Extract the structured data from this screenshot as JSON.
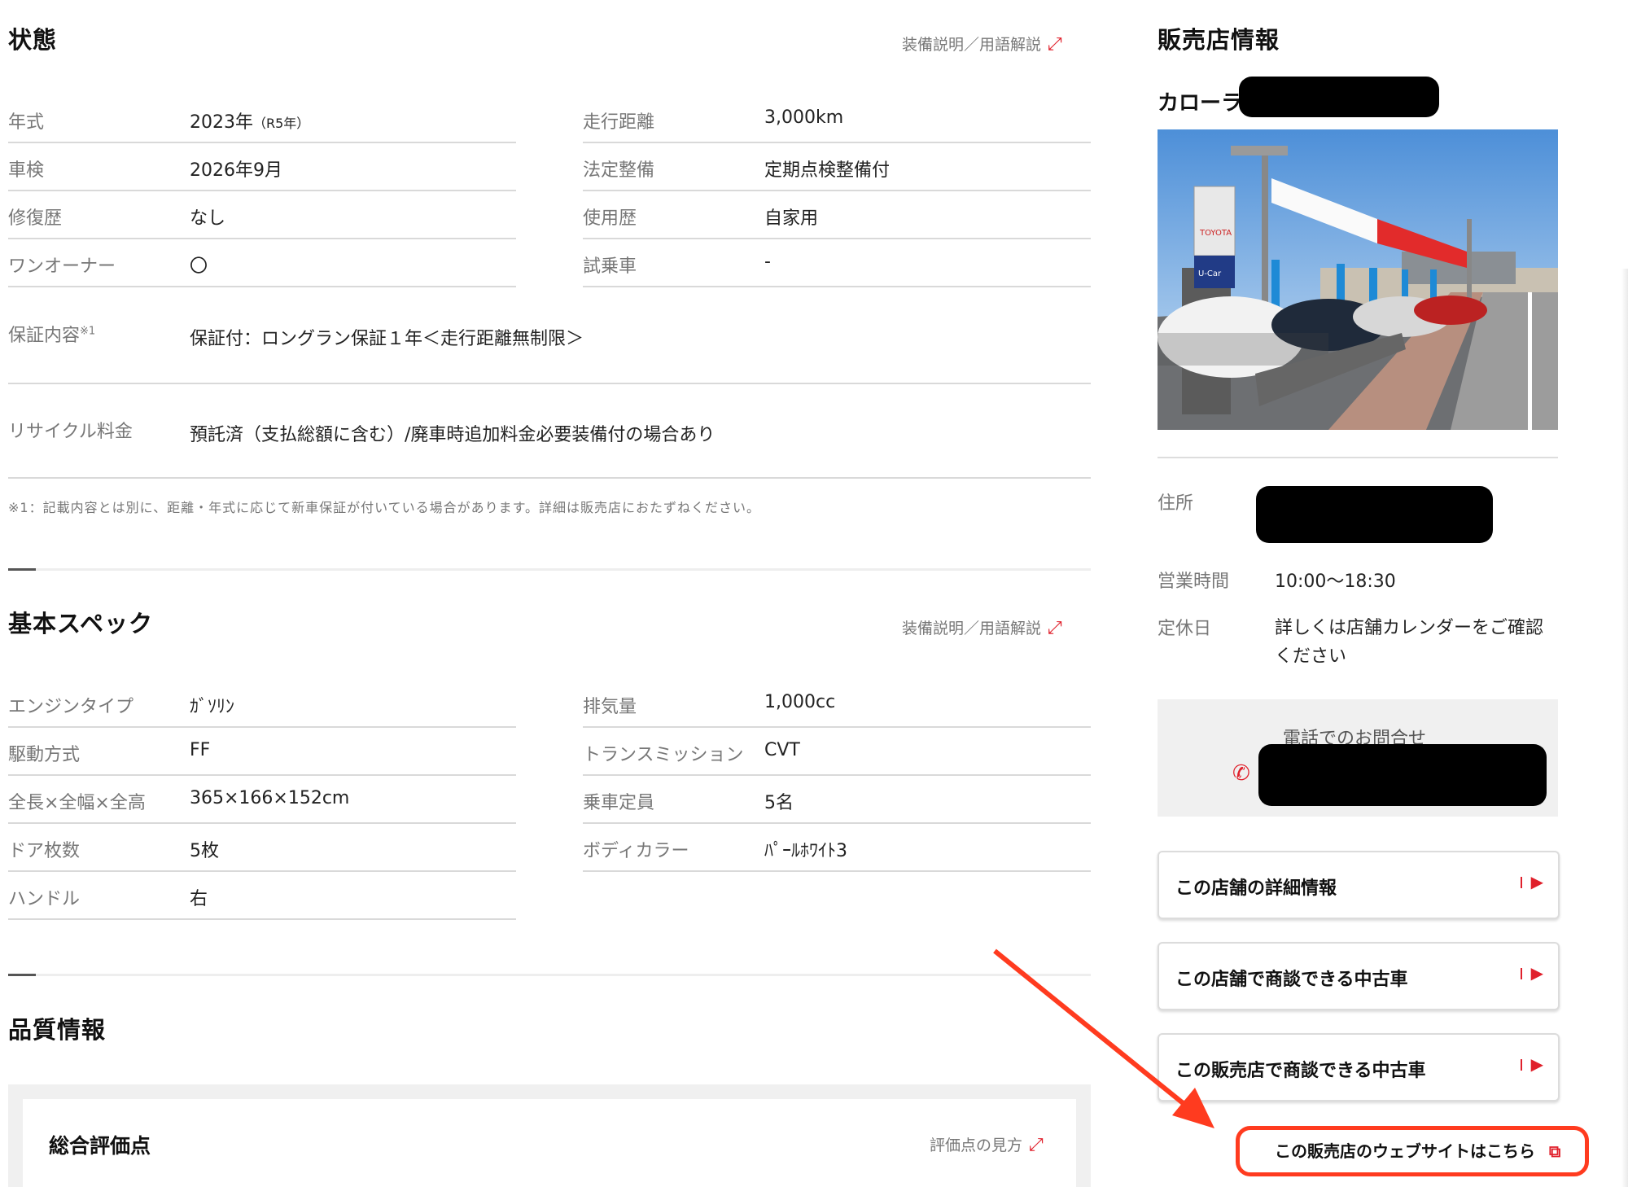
{
  "condition": {
    "title": "状態",
    "glossary_link": "装備説明／用語解説",
    "left_rows": [
      {
        "label": "年式",
        "value": "2023年",
        "sub": "（R5年）"
      },
      {
        "label": "車検",
        "value": "2026年9月"
      },
      {
        "label": "修復歴",
        "value": "なし"
      },
      {
        "label": "ワンオーナー",
        "value": "〇"
      }
    ],
    "right_rows": [
      {
        "label": "走行距離",
        "value": "3,000km"
      },
      {
        "label": "法定整備",
        "value": "定期点検整備付"
      },
      {
        "label": "使用歴",
        "value": "自家用"
      },
      {
        "label": "試乗車",
        "value": "-"
      }
    ],
    "warranty_label": "保証内容",
    "warranty_note_mark": "※1",
    "warranty_value": "保証付：ロングラン保証１年＜走行距離無制限＞",
    "recycle_label": "リサイクル料金",
    "recycle_value": "預託済（支払総額に含む）/廃車時追加料金必要装備付の場合あり",
    "footnote": "※1：記載内容とは別に、距離・年式に応じて新車保証が付いている場合があります。詳細は販売店におたずねください。"
  },
  "specs": {
    "title": "基本スペック",
    "glossary_link": "装備説明／用語解説",
    "left_rows": [
      {
        "label": "エンジンタイプ",
        "value": "ｶﾞｿﾘﾝ"
      },
      {
        "label": "駆動方式",
        "value": "FF"
      },
      {
        "label": "全長×全幅×全高",
        "value": "365×166×152cm"
      },
      {
        "label": "ドア枚数",
        "value": "5枚"
      },
      {
        "label": "ハンドル",
        "value": "右"
      }
    ],
    "right_rows": [
      {
        "label": "排気量",
        "value": "1,000cc"
      },
      {
        "label": "トランスミッション",
        "value": "CVT"
      },
      {
        "label": "乗車定員",
        "value": "5名"
      },
      {
        "label": "ボディカラー",
        "value": "ﾊﾟｰﾙﾎﾜｲﾄ3"
      }
    ]
  },
  "quality": {
    "title": "品質情報",
    "score_title": "総合評価点",
    "score_link": "評価点の見方"
  },
  "dealer": {
    "title": "販売店情報",
    "name_prefix": "カローラ",
    "address_label": "住所",
    "hours_label": "営業時間",
    "hours_value": "10:00〜18:30",
    "holiday_label": "定休日",
    "holiday_value_line1": "詳しくは店舗カレンダーをご確認",
    "holiday_value_line2": "ください",
    "phone_label": "電話でのお問合せ",
    "buttons": [
      "この店舗の詳細情報",
      "この店舗で商談できる中古車",
      "この販売店で商談できる中古車"
    ],
    "website_link": "この販売店のウェブサイトはこちら",
    "photo_signs": {
      "toyota": "TOYOTA",
      "ucar": "U-Car"
    }
  },
  "colors": {
    "accent_red": "#e0202b",
    "annotation_red": "#ff3b1f"
  },
  "icons": [
    "external-link-icon",
    "phone-icon",
    "arrow-right-icon",
    "new-window-icon"
  ]
}
